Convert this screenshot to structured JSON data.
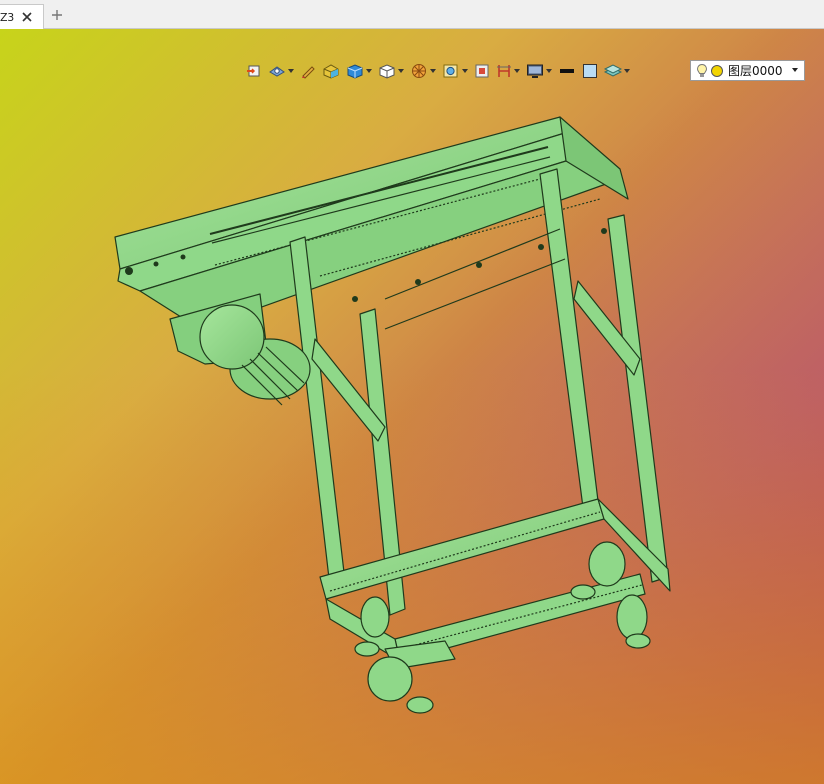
{
  "tabs": [
    {
      "label": "Z3",
      "active": true
    }
  ],
  "toolbar": {
    "buttons": [
      {
        "icon": "view-orient-icon",
        "dropdown": false
      },
      {
        "icon": "render-mode-icon",
        "dropdown": true
      },
      {
        "icon": "pen-sketch-icon",
        "dropdown": false
      },
      {
        "icon": "part-color-icon",
        "dropdown": false
      },
      {
        "icon": "solid-box-icon",
        "dropdown": true
      },
      {
        "icon": "wire-cube-icon",
        "dropdown": true
      },
      {
        "icon": "section-icon",
        "dropdown": true
      },
      {
        "icon": "zoom-fit-icon",
        "dropdown": true
      },
      {
        "icon": "clipping-icon",
        "dropdown": false
      },
      {
        "icon": "dimension-icon",
        "dropdown": true
      },
      {
        "icon": "display-icon",
        "dropdown": true
      },
      {
        "icon": "line-weight-icon",
        "dropdown": false
      },
      {
        "icon": "color-swatch-icon",
        "dropdown": false
      },
      {
        "icon": "layer-stack-icon",
        "dropdown": true
      }
    ]
  },
  "layer": {
    "value": "图层0000",
    "swatch_color": "#f2d400"
  },
  "colors": {
    "model_fill": "#8fd889",
    "model_edge": "#1f3a1c"
  }
}
